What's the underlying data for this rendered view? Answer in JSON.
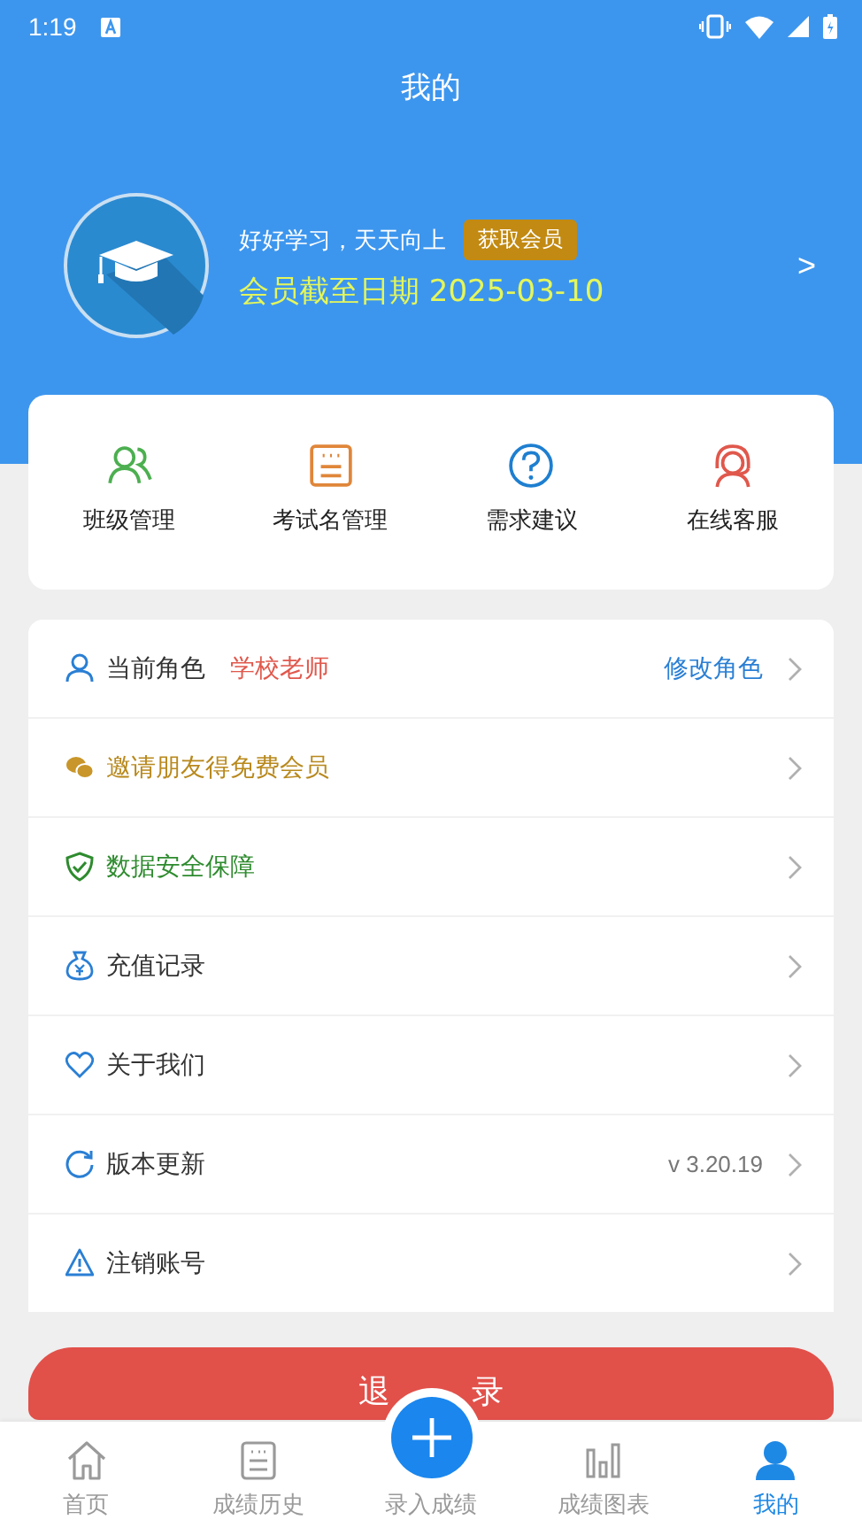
{
  "status_bar": {
    "time": "1:19"
  },
  "header": {
    "title": "我的"
  },
  "profile": {
    "motto": "好好学习，天天向上",
    "badge": "获取会员",
    "expiry": "会员截至日期 2025-03-10",
    "chevron": ">"
  },
  "shortcuts": [
    {
      "kind": "people",
      "label": "班级管理",
      "color": "#4caf50"
    },
    {
      "kind": "list",
      "label": "考试名管理",
      "color": "#e0863a"
    },
    {
      "kind": "question",
      "label": "需求建议",
      "color": "#1e7fd0"
    },
    {
      "kind": "headset",
      "label": "在线客服",
      "color": "#e0584c"
    }
  ],
  "menu": [
    {
      "kind": "person",
      "label": "当前角色",
      "color": "#333333",
      "value": "学校老师",
      "action": "修改角色"
    },
    {
      "kind": "chat",
      "label": "邀请朋友得免费会员",
      "color": "#b8891e"
    },
    {
      "kind": "shield",
      "label": "数据安全保障",
      "color": "#2e8b2e"
    },
    {
      "kind": "bag",
      "label": "充值记录",
      "color": "#333333"
    },
    {
      "kind": "heart",
      "label": "关于我们",
      "color": "#333333"
    },
    {
      "kind": "refresh",
      "label": "版本更新",
      "color": "#333333",
      "detail": "v 3.20.19"
    },
    {
      "kind": "warning",
      "label": "注销账号",
      "color": "#333333"
    }
  ],
  "logout": {
    "label_left": "退",
    "label_right": "录"
  },
  "nav": [
    {
      "kind": "home",
      "label": "首页",
      "selected": false
    },
    {
      "kind": "history",
      "label": "成绩历史",
      "selected": false
    },
    {
      "kind": "add",
      "label": "录入成绩",
      "selected": false
    },
    {
      "kind": "chart",
      "label": "成绩图表",
      "selected": false
    },
    {
      "kind": "me",
      "label": "我的",
      "selected": true
    }
  ]
}
